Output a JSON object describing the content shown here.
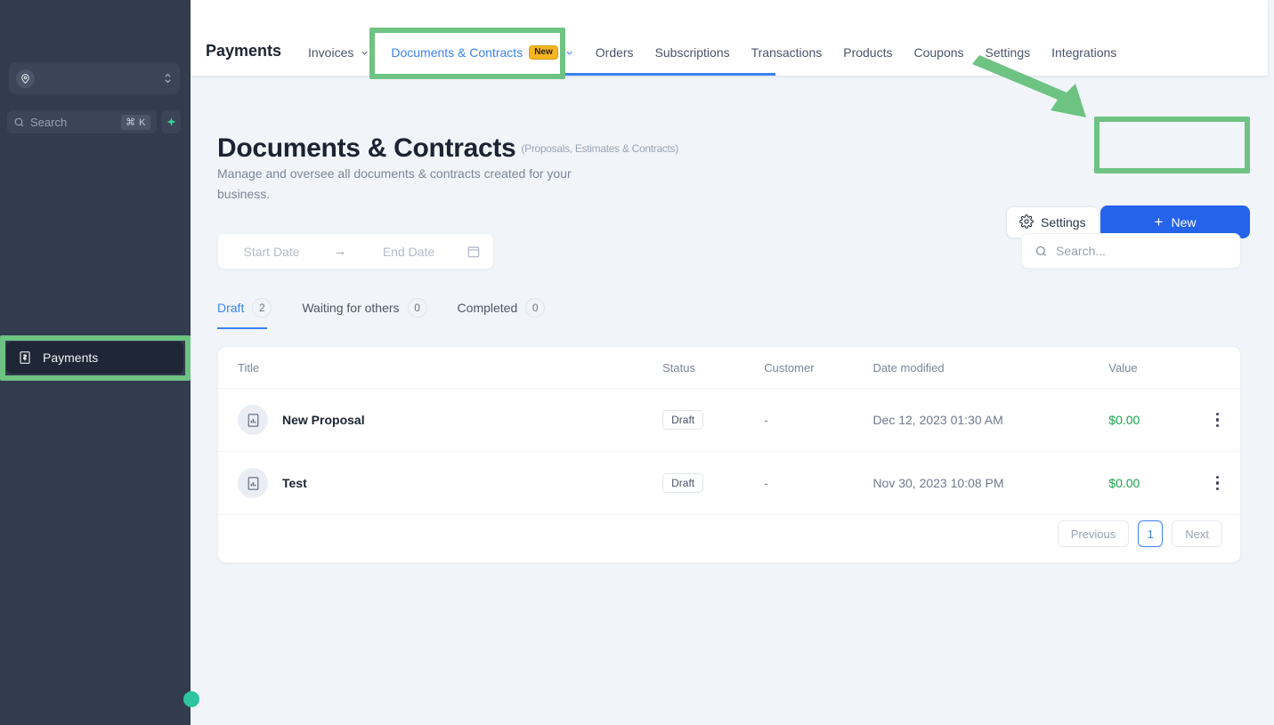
{
  "sidebar": {
    "account": {
      "icon": "account-pin-icon",
      "value": ""
    },
    "search": {
      "placeholder": "Search",
      "shortcut": "⌘ K",
      "icon": "search-icon"
    },
    "ai_button": {
      "icon": "sparkle-icon"
    },
    "items": [
      {
        "label": "Payments",
        "icon": "payments-bill-icon",
        "active": true
      }
    ]
  },
  "topnav": {
    "brand": "Payments",
    "items": [
      {
        "label": "Invoices",
        "has_chevron": true,
        "badge": "",
        "active": false
      },
      {
        "label": "Documents & Contracts",
        "has_chevron": true,
        "badge": "New",
        "active": true
      },
      {
        "label": "Orders",
        "has_chevron": false,
        "badge": "",
        "active": false
      },
      {
        "label": "Subscriptions",
        "has_chevron": false,
        "badge": "",
        "active": false
      },
      {
        "label": "Transactions",
        "has_chevron": false,
        "badge": "",
        "active": false
      },
      {
        "label": "Products",
        "has_chevron": false,
        "badge": "",
        "active": false
      },
      {
        "label": "Coupons",
        "has_chevron": false,
        "badge": "",
        "active": false
      },
      {
        "label": "Settings",
        "has_chevron": false,
        "badge": "",
        "active": false
      },
      {
        "label": "Integrations",
        "has_chevron": false,
        "badge": "",
        "active": false
      }
    ]
  },
  "page": {
    "title": "Documents & Contracts",
    "title_sub": "(Proposals, Estimates & Contracts)",
    "description": "Manage and oversee all documents & contracts created for your business.",
    "settings_button": "Settings",
    "new_button": "New",
    "new_button_plus": "+"
  },
  "filters": {
    "start_date_placeholder": "Start Date",
    "end_date_placeholder": "End Date",
    "range_arrow": "→",
    "calendar_icon": "calendar-icon",
    "search_placeholder": "Search..."
  },
  "tabs": [
    {
      "label": "Draft",
      "count": "2",
      "active": true
    },
    {
      "label": "Waiting for others",
      "count": "0",
      "active": false
    },
    {
      "label": "Completed",
      "count": "0",
      "active": false
    }
  ],
  "table": {
    "columns": [
      "Title",
      "Status",
      "Customer",
      "Date modified",
      "Value"
    ],
    "rows": [
      {
        "title": "New Proposal",
        "status": "Draft",
        "customer": "-",
        "date_modified": "Dec 12, 2023 01:30 AM",
        "value": "$0.00",
        "icon": "document-chart-icon"
      },
      {
        "title": "Test",
        "status": "Draft",
        "customer": "-",
        "date_modified": "Nov 30, 2023 10:08 PM",
        "value": "$0.00",
        "icon": "document-chart-icon"
      }
    ]
  },
  "pagination": {
    "previous": "Previous",
    "current_page": "1",
    "next": "Next"
  },
  "colors": {
    "accent_blue": "#2563eb",
    "link_blue": "#3b82f6",
    "highlight_green": "#6ec282",
    "badge_yellow": "#f5b622",
    "value_green": "#16a34a",
    "sidebar_bg": "#333b4e",
    "page_bg": "#f1f5f9"
  }
}
